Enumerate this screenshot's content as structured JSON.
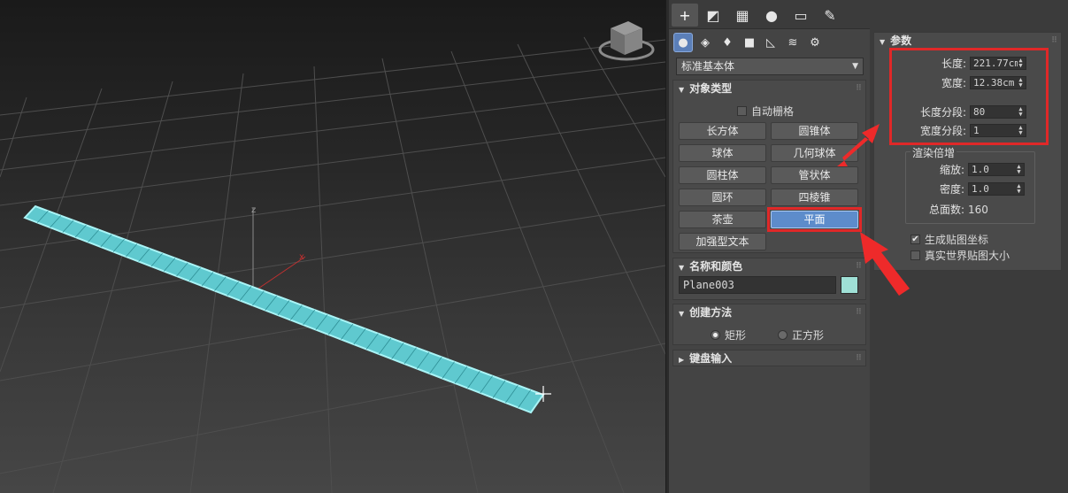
{
  "tabs": [
    {
      "icon": "create-plus-icon",
      "glyph": "+"
    },
    {
      "icon": "modify-curve-icon",
      "glyph": "◩"
    },
    {
      "icon": "hierarchy-icon",
      "glyph": "▦"
    },
    {
      "icon": "motion-icon",
      "glyph": "●"
    },
    {
      "icon": "display-icon",
      "glyph": "▭"
    },
    {
      "icon": "utilities-wrench-icon",
      "glyph": "✎"
    }
  ],
  "subtabs": [
    {
      "icon": "geometry-sphere-icon",
      "glyph": "●"
    },
    {
      "icon": "shapes-icon",
      "glyph": "◈"
    },
    {
      "icon": "lights-icon",
      "glyph": "♦"
    },
    {
      "icon": "cameras-icon",
      "glyph": "■"
    },
    {
      "icon": "helpers-icon",
      "glyph": "◺"
    },
    {
      "icon": "spacewarps-icon",
      "glyph": "≋"
    },
    {
      "icon": "systems-icon",
      "glyph": "⚙"
    }
  ],
  "category": "标准基本体",
  "object_type": {
    "title": "对象类型",
    "autogrid_label": "自动栅格",
    "buttons": [
      "长方体",
      "圆锥体",
      "球体",
      "几何球体",
      "圆柱体",
      "管状体",
      "圆环",
      "四棱锥",
      "茶壶",
      "平面",
      "加强型文本"
    ],
    "active_button": "平面"
  },
  "name_color": {
    "title": "名称和颜色",
    "name": "Plane003",
    "color": "#9fe0d6"
  },
  "creation_method": {
    "title": "创建方法",
    "options": [
      "矩形",
      "正方形"
    ],
    "selected": "矩形"
  },
  "keyboard_entry": {
    "title": "键盘输入"
  },
  "parameters": {
    "title": "参数",
    "length_label": "长度:",
    "length_value": "221.77cm",
    "width_label": "宽度:",
    "width_value": "12.38cm",
    "length_segs_label": "长度分段:",
    "length_segs_value": "80",
    "width_segs_label": "宽度分段:",
    "width_segs_value": "1",
    "render_group_title": "渲染倍增",
    "scale_label": "缩放:",
    "scale_value": "1.0",
    "density_label": "密度:",
    "density_value": "1.0",
    "total_faces_label": "总面数:",
    "total_faces_value": "160",
    "gen_mapping_label": "生成贴图坐标",
    "gen_mapping_checked": true,
    "real_world_label": "真实世界贴图大小",
    "real_world_checked": false
  },
  "viewport": {
    "axis_labels": {
      "x": "x",
      "y": "y",
      "z": "z"
    },
    "object_color": "#7fe6ea"
  }
}
